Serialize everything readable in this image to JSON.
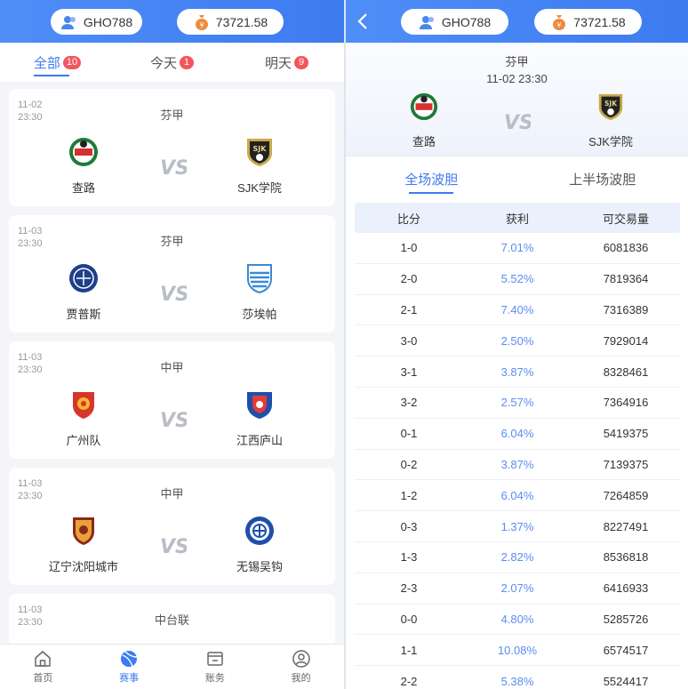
{
  "user": {
    "name": "GHO788",
    "balance": "73721.58"
  },
  "left": {
    "tabs": [
      {
        "label": "全部",
        "count": "10"
      },
      {
        "label": "今天",
        "count": "1"
      },
      {
        "label": "明天",
        "count": "9"
      }
    ],
    "matches": [
      {
        "date": "11-02",
        "time": "23:30",
        "league": "芬甲",
        "home": "查路",
        "away": "SJK学院"
      },
      {
        "date": "11-03",
        "time": "23:30",
        "league": "芬甲",
        "home": "贾普斯",
        "away": "莎埃帕"
      },
      {
        "date": "11-03",
        "time": "23:30",
        "league": "中甲",
        "home": "广州队",
        "away": "江西庐山"
      },
      {
        "date": "11-03",
        "time": "23:30",
        "league": "中甲",
        "home": "辽宁沈阳城市",
        "away": "无锡吴钩"
      },
      {
        "date": "11-03",
        "time": "23:30",
        "league": "中台联",
        "home": "",
        "away": ""
      }
    ],
    "nav": [
      {
        "label": "首页",
        "icon": "home-icon"
      },
      {
        "label": "赛事",
        "icon": "ball-icon"
      },
      {
        "label": "账务",
        "icon": "wallet-icon"
      },
      {
        "label": "我的",
        "icon": "profile-icon"
      }
    ]
  },
  "detail": {
    "league": "芬甲",
    "datetime": "11-02 23:30",
    "home": "查路",
    "away": "SJK学院",
    "tabs": [
      "全场波胆",
      "上半场波胆"
    ],
    "headers": [
      "比分",
      "获利",
      "可交易量"
    ],
    "rows": [
      [
        "1-0",
        "7.01%",
        "6081836"
      ],
      [
        "2-0",
        "5.52%",
        "7819364"
      ],
      [
        "2-1",
        "7.40%",
        "7316389"
      ],
      [
        "3-0",
        "2.50%",
        "7929014"
      ],
      [
        "3-1",
        "3.87%",
        "8328461"
      ],
      [
        "3-2",
        "2.57%",
        "7364916"
      ],
      [
        "0-1",
        "6.04%",
        "5419375"
      ],
      [
        "0-2",
        "3.87%",
        "7139375"
      ],
      [
        "1-2",
        "6.04%",
        "7264859"
      ],
      [
        "0-3",
        "1.37%",
        "8227491"
      ],
      [
        "1-3",
        "2.82%",
        "8536818"
      ],
      [
        "2-3",
        "2.07%",
        "6416933"
      ],
      [
        "0-0",
        "4.80%",
        "5285726"
      ],
      [
        "1-1",
        "10.08%",
        "6574517"
      ],
      [
        "2-2",
        "5.38%",
        "5524417"
      ]
    ]
  },
  "colors": {
    "primary": "#3d7bf0",
    "badge": "#f2565c",
    "profit": "#5b8def"
  }
}
